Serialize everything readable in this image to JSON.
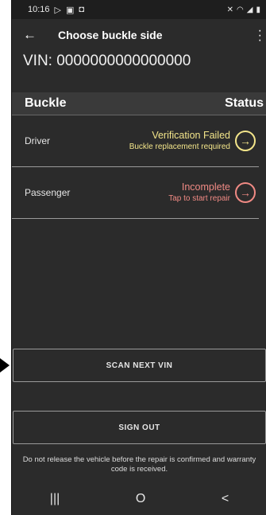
{
  "status_bar": {
    "time": "10:16",
    "left_icons": [
      "play-icon",
      "image-icon",
      "notification-icon"
    ],
    "right_icons": [
      "mute-icon",
      "wifi-icon",
      "signal-icon",
      "battery-icon"
    ]
  },
  "app_bar": {
    "back_icon": "arrow-left-icon",
    "title": "Choose buckle side",
    "menu_icon": "more-vertical-icon"
  },
  "vin": "VIN: 0000000000000000",
  "table": {
    "header_left": "Buckle",
    "header_right": "Status",
    "rows": [
      {
        "name": "Driver",
        "status": "Verification Failed",
        "substatus": "Buckle replacement required",
        "color": "#f3e58a"
      },
      {
        "name": "Passenger",
        "status": "Incomplete",
        "substatus": "Tap to start repair",
        "color": "#f08a84"
      }
    ]
  },
  "buttons": {
    "scan_next": "SCAN NEXT VIN",
    "sign_out": "SIGN OUT"
  },
  "notice": "Do not release the vehicle before the repair is confirmed and warranty code is received.",
  "nav": {
    "recents": "|||",
    "home": "O",
    "back": "<"
  }
}
